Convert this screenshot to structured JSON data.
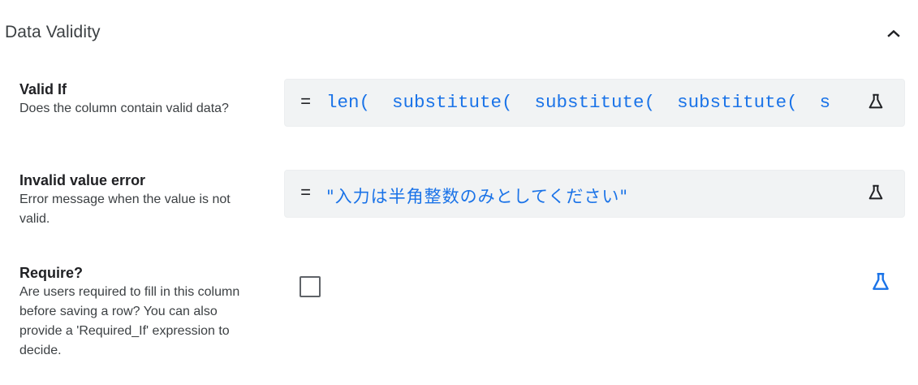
{
  "section": {
    "title": "Data Validity",
    "collapse_icon": "chevron-up-icon"
  },
  "valid_if": {
    "title": "Valid If",
    "description": "Does the column contain valid data?",
    "operator": "=",
    "expression": "len(  substitute(  substitute(  substitute(  s",
    "icon": "flask-icon"
  },
  "invalid_error": {
    "title": "Invalid value error",
    "description": "Error message when the value is not valid.",
    "operator": "=",
    "expression": "\"入力は半角整数のみとしてください\"",
    "icon": "flask-icon"
  },
  "require": {
    "title": "Require?",
    "description": "Are users required to fill in this column before saving a row? You can also provide a 'Required_If' expression to decide.",
    "checked": false,
    "icon": "flask-icon",
    "icon_color": "#1a73e8"
  },
  "colors": {
    "expression_text": "#1a73e8",
    "field_background": "#f1f3f4",
    "accent": "#1a73e8"
  }
}
